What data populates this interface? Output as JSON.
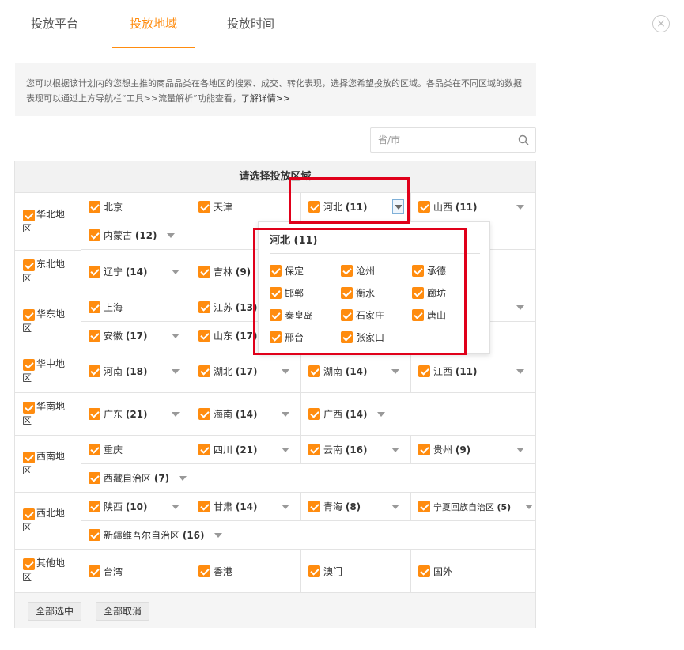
{
  "tabs": [
    {
      "label": "投放平台",
      "active": false
    },
    {
      "label": "投放地域",
      "active": true
    },
    {
      "label": "投放时间",
      "active": false
    }
  ],
  "close_icon": "×",
  "info": {
    "text": "您可以根据该计划内的您想主推的商品品类在各地区的搜索、成交、转化表现，选择您希望投放的区域。各品类在不同区域的数据表现可以通过上方导航栏“工具>>流量解析”功能查看，",
    "link": "了解详情>>"
  },
  "search": {
    "placeholder": "省/市",
    "value": ""
  },
  "table": {
    "header": "请选择投放区域",
    "regions": [
      {
        "name": "华北地区",
        "provinces": [
          {
            "name": "北京",
            "count": "",
            "dropdown": false
          },
          {
            "name": "天津",
            "count": "",
            "dropdown": false
          },
          {
            "name": "河北",
            "count": "(11)",
            "dropdown": true
          },
          {
            "name": "山西",
            "count": "(11)",
            "dropdown": true
          },
          {
            "name": "内蒙古",
            "count": "(12)",
            "dropdown": true
          }
        ]
      },
      {
        "name": "东北地区",
        "provinces": [
          {
            "name": "辽宁",
            "count": "(14)",
            "dropdown": true
          },
          {
            "name": "吉林",
            "count": "(9)",
            "dropdown": true
          }
        ]
      },
      {
        "name": "华东地区",
        "provinces": [
          {
            "name": "上海",
            "count": "",
            "dropdown": false
          },
          {
            "name": "江苏",
            "count": "(13)",
            "dropdown": true
          },
          {
            "name": "安徽",
            "count": "(17)",
            "dropdown": true
          },
          {
            "name": "山东",
            "count": "(17)",
            "dropdown": true
          }
        ]
      },
      {
        "name": "华中地区",
        "provinces": [
          {
            "name": "河南",
            "count": "(18)",
            "dropdown": true
          },
          {
            "name": "湖北",
            "count": "(17)",
            "dropdown": true
          },
          {
            "name": "湖南",
            "count": "(14)",
            "dropdown": true
          },
          {
            "name": "江西",
            "count": "(11)",
            "dropdown": true
          }
        ]
      },
      {
        "name": "华南地区",
        "provinces": [
          {
            "name": "广东",
            "count": "(21)",
            "dropdown": true
          },
          {
            "name": "海南",
            "count": "(14)",
            "dropdown": true
          },
          {
            "name": "广西",
            "count": "(14)",
            "dropdown": true
          }
        ]
      },
      {
        "name": "西南地区",
        "provinces": [
          {
            "name": "重庆",
            "count": "",
            "dropdown": false
          },
          {
            "name": "四川",
            "count": "(21)",
            "dropdown": true
          },
          {
            "name": "云南",
            "count": "(16)",
            "dropdown": true
          },
          {
            "name": "贵州",
            "count": "(9)",
            "dropdown": true
          },
          {
            "name": "西藏自治区",
            "count": "(7)",
            "dropdown": true
          }
        ]
      },
      {
        "name": "西北地区",
        "provinces": [
          {
            "name": "陕西",
            "count": "(10)",
            "dropdown": true
          },
          {
            "name": "甘肃",
            "count": "(14)",
            "dropdown": true
          },
          {
            "name": "青海",
            "count": "(8)",
            "dropdown": true
          },
          {
            "name": "宁夏回族自治区",
            "count": "(5)",
            "dropdown": true
          },
          {
            "name": "新疆维吾尔自治区",
            "count": "(16)",
            "dropdown": true
          }
        ]
      },
      {
        "name": "其他地区",
        "provinces": [
          {
            "name": "台湾",
            "count": "",
            "dropdown": false
          },
          {
            "name": "香港",
            "count": "",
            "dropdown": false
          },
          {
            "name": "澳门",
            "count": "",
            "dropdown": false
          },
          {
            "name": "国外",
            "count": "",
            "dropdown": false
          }
        ]
      }
    ],
    "footer": {
      "select_all": "全部选中",
      "deselect_all": "全部取消"
    }
  },
  "popup": {
    "title": "河北 (11)",
    "cities": [
      "保定",
      "沧州",
      "承德",
      "邯郸",
      "衡水",
      "廊坊",
      "秦皇岛",
      "石家庄",
      "唐山",
      "邢台",
      "张家口"
    ]
  },
  "colors": {
    "accent": "#ff8c0f",
    "highlight": "#e0001a",
    "border": "#e3e3e3"
  },
  "icons": {
    "checkbox": "checkbox-checked-icon",
    "caret": "caret-down-icon",
    "search": "search-icon",
    "close": "close-icon"
  }
}
